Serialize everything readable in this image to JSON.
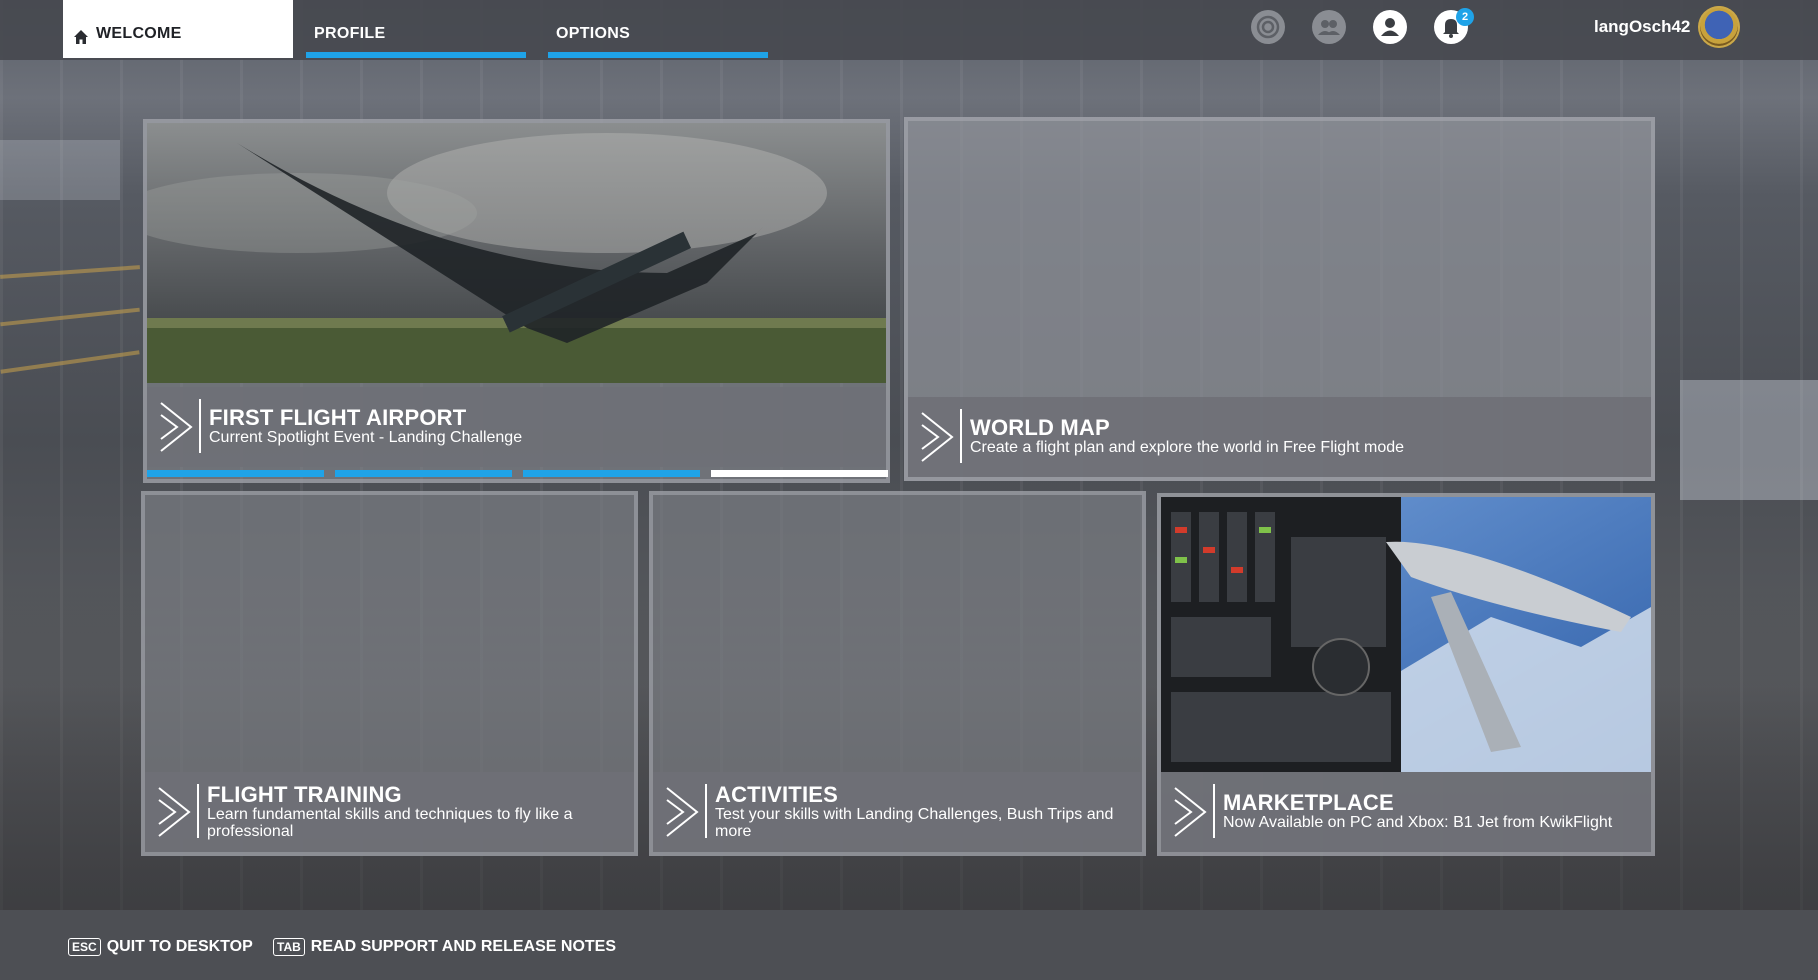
{
  "nav": {
    "tabs": [
      {
        "label": "WELCOME",
        "active": true
      },
      {
        "label": "PROFILE",
        "active": false
      },
      {
        "label": "OPTIONS",
        "active": false
      }
    ],
    "icons": [
      "achievements-icon",
      "friends-icon",
      "account-icon",
      "notifications-icon"
    ],
    "notification_count": "2",
    "username": "langOsch42"
  },
  "tiles": {
    "first_flight": {
      "title": "FIRST FLIGHT AIRPORT",
      "subtitle": "Current Spotlight Event - Landing Challenge",
      "carousel_pages": 4,
      "carousel_current": 4
    },
    "world_map": {
      "title": "WORLD MAP",
      "subtitle": "Create a flight plan and explore the world in Free Flight mode"
    },
    "flight_training": {
      "title": "FLIGHT TRAINING",
      "subtitle": "Learn fundamental skills and techniques to fly like a professional"
    },
    "activities": {
      "title": "ACTIVITIES",
      "subtitle": "Test your skills with Landing Challenges, Bush Trips and more"
    },
    "marketplace": {
      "title": "MARKETPLACE",
      "subtitle": "Now Available on PC and Xbox: B1 Jet from KwikFlight"
    }
  },
  "footer": {
    "quit_key": "ESC",
    "quit_label": "QUIT TO DESKTOP",
    "notes_key": "TAB",
    "notes_label": "READ SUPPORT AND RELEASE NOTES"
  },
  "colors": {
    "accent": "#1fa3e8",
    "text": "#ffffff",
    "topbar": "#46494f"
  }
}
